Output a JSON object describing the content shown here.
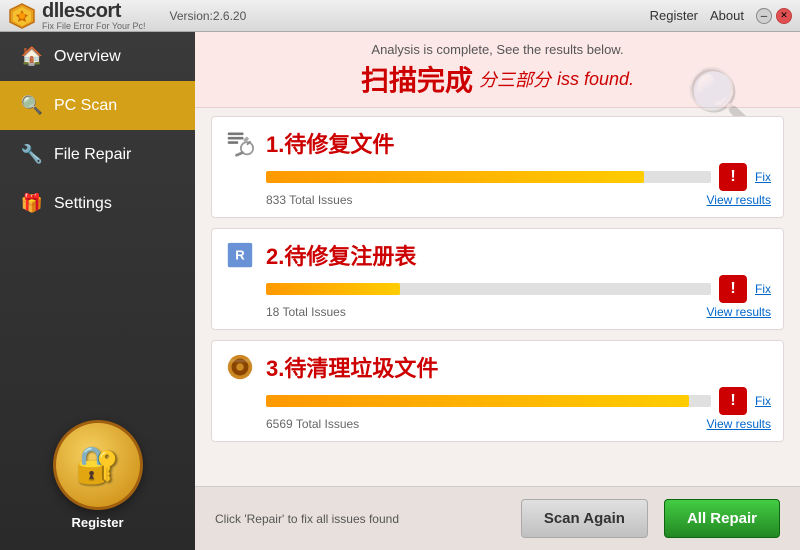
{
  "titlebar": {
    "brand": "dllescort",
    "tagline": "Fix File Error For Your Pc!",
    "version": "Version:2.6.20",
    "register_label": "Register",
    "about_label": "About"
  },
  "sidebar": {
    "items": [
      {
        "id": "overview",
        "label": "Overview",
        "icon": "🏠",
        "active": false
      },
      {
        "id": "pc-scan",
        "label": "PC Scan",
        "icon": "🔍",
        "active": true
      },
      {
        "id": "file-repair",
        "label": "File Repair",
        "icon": "🔧",
        "active": false
      },
      {
        "id": "settings",
        "label": "Settings",
        "icon": "🎁",
        "active": false
      }
    ],
    "register_label": "Register"
  },
  "content": {
    "analysis_subtitle": "Analysis is complete, See the results below.",
    "main_title": "扫描完成 iss分三部分found.",
    "scan_complete": "扫描完成",
    "issues_label": "iss found.",
    "sections_label": "分三部分",
    "scan_items": [
      {
        "id": "file-repair",
        "title": "1.待修复文件",
        "total_issues": "833 Total Issues",
        "fix_label": "Fix",
        "view_results_label": "View results",
        "bar_percent": 85,
        "icon_type": "wrench"
      },
      {
        "id": "registry-cleaner",
        "title": "2.待修复注册表",
        "total_issues": "18 Total Issues",
        "fix_label": "Fix",
        "view_results_label": "View results",
        "bar_percent": 30,
        "icon_type": "registry"
      },
      {
        "id": "disk-cleaner",
        "title": "3.待清理垃圾文件",
        "total_issues": "6569 Total Issues",
        "fix_label": "Fix",
        "view_results_label": "View results",
        "bar_percent": 95,
        "icon_type": "disk"
      }
    ]
  },
  "bottom": {
    "hint": "Click 'Repair' to fix all issues found",
    "scan_again_label": "Scan Again",
    "all_repair_label": "All Repair"
  },
  "colors": {
    "active_nav": "#d4a017",
    "red_title": "#cc0000",
    "green_btn": "#228822",
    "fix_link": "#0066cc"
  }
}
